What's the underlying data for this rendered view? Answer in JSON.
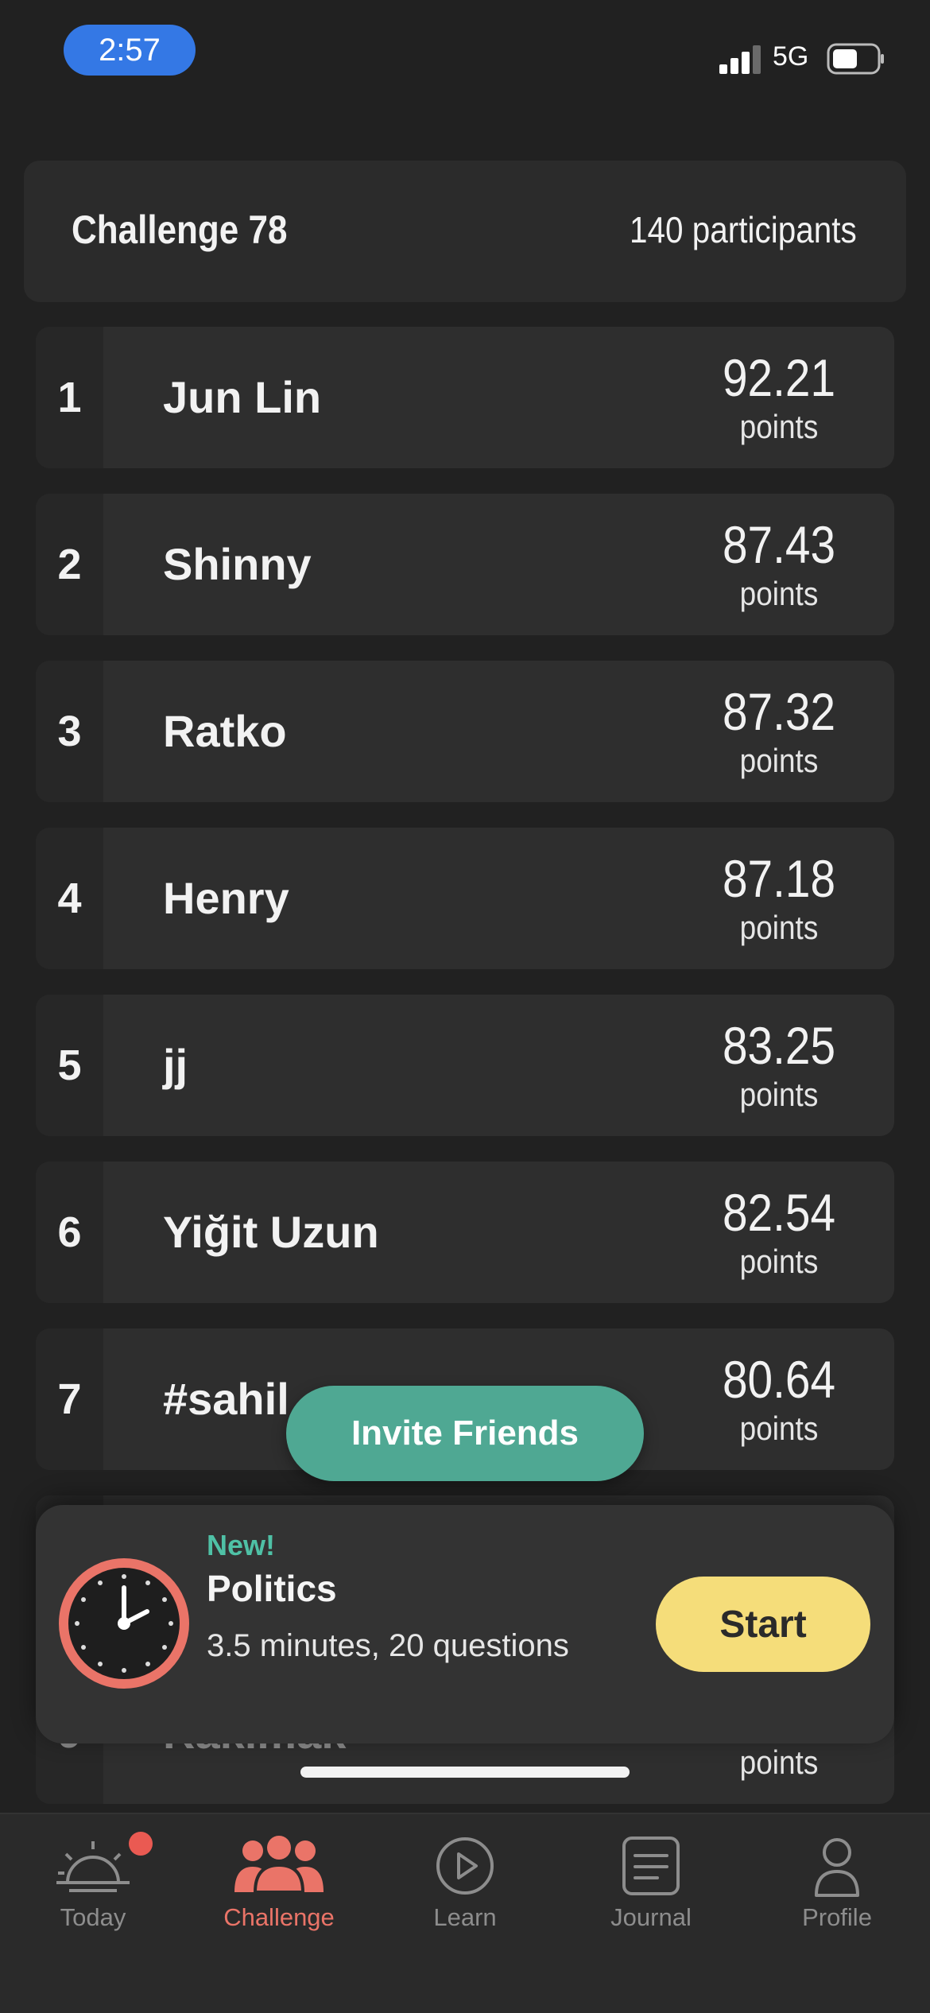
{
  "status_bar": {
    "time": "2:57",
    "network": "5G",
    "signal_icon": "cellular-signal-icon",
    "battery_icon": "battery-icon"
  },
  "header": {
    "title": "Challenge 78",
    "participants": "140 participants"
  },
  "leaderboard": [
    {
      "rank": "1",
      "name": "Jun Lin",
      "score": "92.21",
      "unit": "points"
    },
    {
      "rank": "2",
      "name": "Shinny",
      "score": "87.43",
      "unit": "points"
    },
    {
      "rank": "3",
      "name": "Ratko",
      "score": "87.32",
      "unit": "points"
    },
    {
      "rank": "4",
      "name": "Henry",
      "score": "87.18",
      "unit": "points"
    },
    {
      "rank": "5",
      "name": "jj",
      "score": "83.25",
      "unit": "points"
    },
    {
      "rank": "6",
      "name": "Yiğit Uzun",
      "score": "82.54",
      "unit": "points"
    },
    {
      "rank": "7",
      "name": "#sahil",
      "score": "80.64",
      "unit": "points"
    },
    {
      "rank": "",
      "name": "",
      "score": "",
      "unit": ""
    },
    {
      "rank": "9",
      "name": "Rakimak",
      "score": "",
      "unit": "points"
    }
  ],
  "invite": {
    "label": "Invite Friends"
  },
  "promo": {
    "badge": "New!",
    "title": "Politics",
    "subtitle": "3.5 minutes, 20 questions",
    "start_label": "Start",
    "icon": "clock-icon",
    "accent": "#ea7468"
  },
  "tabs": [
    {
      "label": "Today",
      "icon": "sunrise-icon",
      "active": false,
      "has_badge": true
    },
    {
      "label": "Challenge",
      "icon": "group-icon",
      "active": true,
      "has_badge": false
    },
    {
      "label": "Learn",
      "icon": "play-circle-icon",
      "active": false,
      "has_badge": false
    },
    {
      "label": "Journal",
      "icon": "journal-icon",
      "active": false,
      "has_badge": false
    },
    {
      "label": "Profile",
      "icon": "person-icon",
      "active": false,
      "has_badge": false
    }
  ],
  "colors": {
    "background": "#212121",
    "card": "#2e2e2e",
    "invite": "#4fa893",
    "start": "#f5dd7a",
    "active_tab": "#ea7468",
    "new_badge": "#4fc1a6"
  }
}
